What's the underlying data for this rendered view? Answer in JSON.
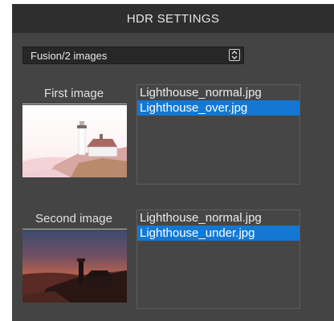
{
  "header": {
    "title": "HDR SETTINGS"
  },
  "mode_select": {
    "value": "Fusion/2 images",
    "icon": "chevron-up-down-icon"
  },
  "first": {
    "label": "First image",
    "files": [
      {
        "name": "Lighthouse_normal.jpg",
        "selected": false
      },
      {
        "name": "Lighthouse_over.jpg",
        "selected": true
      }
    ]
  },
  "second": {
    "label": "Second image",
    "files": [
      {
        "name": "Lighthouse_normal.jpg",
        "selected": false
      },
      {
        "name": "Lighthouse_under.jpg",
        "selected": true
      }
    ]
  },
  "colors": {
    "panel": "#444444",
    "titlebar": "#2e2e2e",
    "selection": "#1478d2"
  }
}
